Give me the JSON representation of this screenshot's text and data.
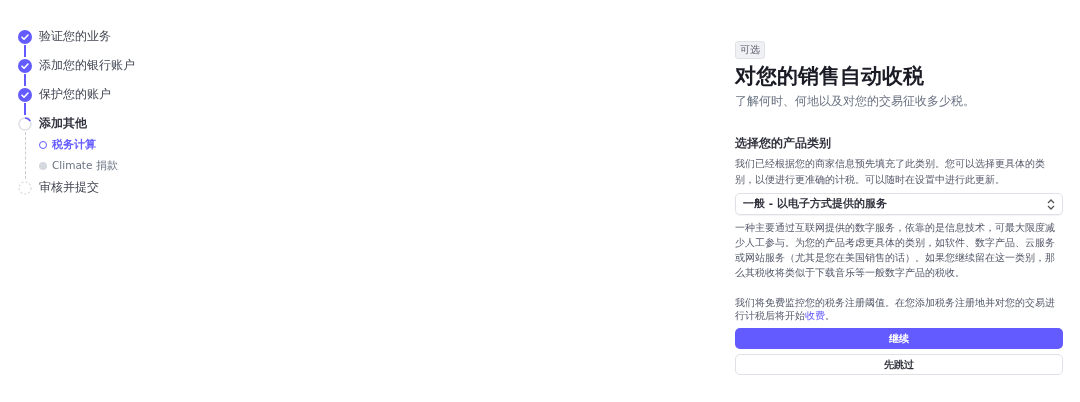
{
  "steps": [
    {
      "label": "验证您的业务",
      "done": true,
      "current": false
    },
    {
      "label": "添加您的银行账户",
      "done": true,
      "current": false
    },
    {
      "label": "保护您的账户",
      "done": true,
      "current": false
    },
    {
      "label": "添加其他",
      "done": false,
      "current": true,
      "children": [
        {
          "label": "税务计算",
          "selected": true
        },
        {
          "label": "Climate 捐款",
          "selected": false
        }
      ]
    },
    {
      "label": "审核并提交",
      "done": false,
      "current": false
    }
  ],
  "badge": "可选",
  "title": "对您的销售自动收税",
  "subtitle": "了解何时、何地以及对您的交易征收多少税。",
  "section_heading": "选择您的产品类别",
  "section_description": "我们已经根据您的商家信息预先填充了此类别。您可以选择更具体的类别，以便进行更准确的计税。可以随时在设置中进行此更新。",
  "category_select": {
    "value": "一般 - 以电子方式提供的服务"
  },
  "category_help": "一种主要通过互联网提供的数字服务，依靠的是信息技术，可最大限度减少人工参与。为您的产品考虑更具体的类别，如软件、数字产品、云服务或网站服务（尤其是您在美国销售的话）。如果您继续留在这一类别，那么其税收将类似于下载音乐等一般数字产品的税收。",
  "note": {
    "text": "我们将免费监控您的税务注册阈值。在您添加税务注册地并对您的交易进行计税后将开始",
    "link": "收费",
    "end": "。"
  },
  "buttons": [
    {
      "label": "继续",
      "kind": "primary"
    },
    {
      "label": "先跳过",
      "kind": "secondary"
    }
  ]
}
